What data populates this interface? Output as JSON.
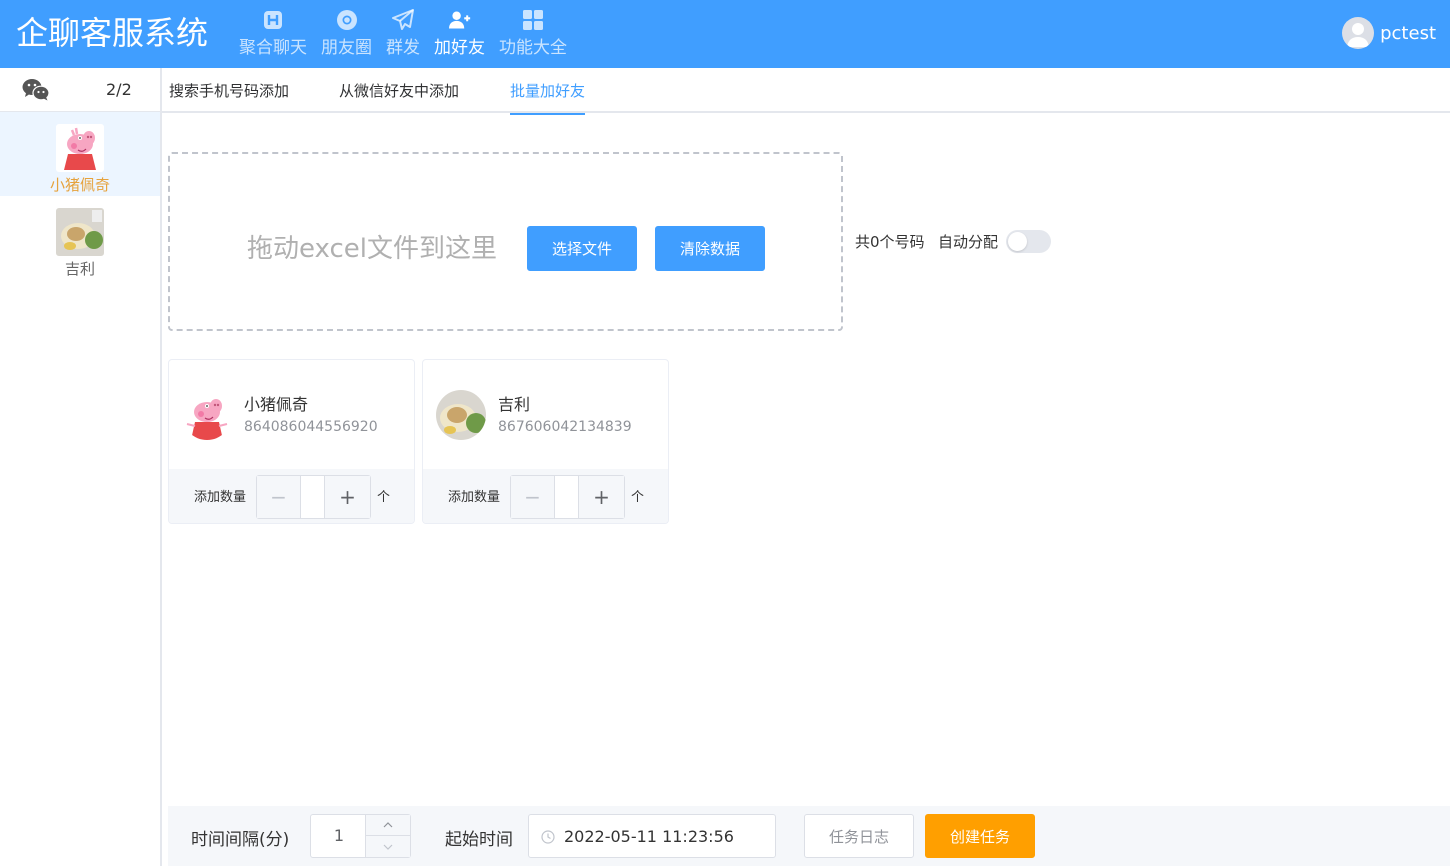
{
  "header": {
    "title": "企聊客服系统",
    "nav": [
      {
        "label": "聚合聊天",
        "icon": "chat-icon"
      },
      {
        "label": "朋友圈",
        "icon": "moments-icon"
      },
      {
        "label": "群发",
        "icon": "send-icon"
      },
      {
        "label": "加好友",
        "icon": "add-friend-icon",
        "active": true
      },
      {
        "label": "功能大全",
        "icon": "grid-icon"
      }
    ],
    "user": "pctest"
  },
  "sidebar": {
    "count": "2/2",
    "accounts": [
      {
        "name": "小猪佩奇",
        "active": true
      },
      {
        "name": "吉利",
        "active": false
      }
    ]
  },
  "tabs": [
    {
      "label": "搜索手机号码添加"
    },
    {
      "label": "从微信好友中添加"
    },
    {
      "label": "批量加好友",
      "active": true
    }
  ],
  "upload": {
    "drop_text": "拖动excel文件到这里",
    "choose_label": "选择文件",
    "clear_label": "清除数据",
    "total_text": "共0个号码",
    "auto_label": "自动分配",
    "auto_enabled": false
  },
  "cards": [
    {
      "name": "小猪佩奇",
      "id": "864086044556920",
      "add_label": "添加数量",
      "minus": "−",
      "plus": "+",
      "unit": "个",
      "quantity": ""
    },
    {
      "name": "吉利",
      "id": "867606042134839",
      "add_label": "添加数量",
      "minus": "−",
      "plus": "+",
      "unit": "个",
      "quantity": ""
    }
  ],
  "bottom": {
    "interval_label": "时间间隔(分)",
    "interval_value": "1",
    "start_label": "起始时间",
    "start_value": "2022-05-11 11:23:56",
    "log_label": "任务日志",
    "create_label": "创建任务"
  },
  "colors": {
    "primary": "#409eff",
    "accent_orange": "#ff9f00",
    "active_account_text": "#e6a23c"
  }
}
